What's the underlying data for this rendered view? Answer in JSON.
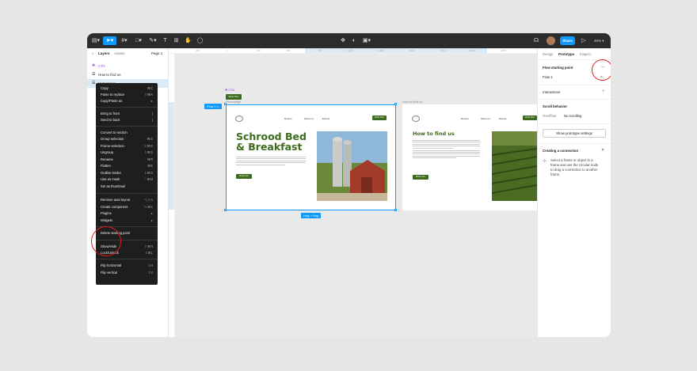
{
  "toolbar": {
    "tools": [
      "main-menu",
      "move",
      "frame",
      "shape",
      "pen",
      "text",
      "resources",
      "hand",
      "comment"
    ],
    "share_label": "Share",
    "zoom": "45%"
  },
  "left_panel": {
    "tabs": {
      "layers": "Layers",
      "assets": "Assets",
      "page": "Page 1"
    },
    "layers": [
      {
        "label": "CTA",
        "icon": "component-icon"
      },
      {
        "label": "How to find us",
        "icon": "frame-icon"
      },
      {
        "label": "Homepage",
        "icon": "frame-icon"
      }
    ]
  },
  "ruler": {
    "top": [
      "250",
      "0",
      "250",
      "500",
      "750",
      "1000",
      "1250",
      "1500",
      "1750",
      "2000",
      "2250"
    ],
    "left": [
      "-500",
      "-250",
      "0",
      "250",
      "500",
      "750",
      "1000",
      "1250"
    ]
  },
  "context_menu": {
    "groups": [
      [
        {
          "label": "Copy",
          "shortcut": "⌘C"
        },
        {
          "label": "Paste to replace",
          "shortcut": "⇧⌘R"
        },
        {
          "label": "Copy/Paste as",
          "shortcut": "▸"
        }
      ],
      [
        {
          "label": "Bring to front",
          "shortcut": "]"
        },
        {
          "label": "Send to back",
          "shortcut": "["
        }
      ],
      [
        {
          "label": "Convert to section",
          "shortcut": ""
        },
        {
          "label": "Group selection",
          "shortcut": "⌘G"
        },
        {
          "label": "Frame selection",
          "shortcut": "⌥⌘G"
        },
        {
          "label": "Ungroup",
          "shortcut": "⇧⌘G"
        },
        {
          "label": "Rename",
          "shortcut": "⌘R"
        },
        {
          "label": "Flatten",
          "shortcut": "⌘E"
        },
        {
          "label": "Outline stroke",
          "shortcut": "⇧⌘O"
        },
        {
          "label": "Use as mask",
          "shortcut": "⌃⌘M"
        },
        {
          "label": "Set as thumbnail",
          "shortcut": ""
        }
      ],
      [
        {
          "label": "Remove auto layout",
          "shortcut": "⌥⇧A"
        },
        {
          "label": "Create component",
          "shortcut": "⌥⌘K"
        },
        {
          "label": "Plugins",
          "shortcut": "▸"
        },
        {
          "label": "Widgets",
          "shortcut": "▸"
        }
      ],
      [
        {
          "label": "Delete starting point",
          "shortcut": ""
        }
      ],
      [
        {
          "label": "Show/Hide",
          "shortcut": "⇧⌘H"
        },
        {
          "label": "Lock/Unlock",
          "shortcut": "⇧⌘L"
        }
      ],
      [
        {
          "label": "Flip horizontal",
          "shortcut": "⇧H"
        },
        {
          "label": "Flip vertical",
          "shortcut": "⇧V"
        }
      ]
    ]
  },
  "canvas": {
    "cta": {
      "label": "CTA",
      "button": "Book Now"
    },
    "homepage": {
      "label": "Homepage",
      "flow_chip": "Flow 1",
      "nav": [
        "Rooms",
        "About us",
        "Events"
      ],
      "nav_button": "Book Now",
      "title_line1": "Schrood Bed",
      "title_line2": "& Breakfast",
      "button": "Book now",
      "size_chip": "Hug × Hug"
    },
    "find_us": {
      "label": "How to find us",
      "nav": [
        "Rooms",
        "About us",
        "Events"
      ],
      "nav_button": "Book Now",
      "title": "How to find us",
      "button": "Book now"
    }
  },
  "right_panel": {
    "tabs": {
      "design": "Design",
      "prototype": "Prototype",
      "inspect": "Inspect"
    },
    "flow_heading": "Flow starting point",
    "flow_name": "Flow 1",
    "interactions": "Interactions",
    "scroll_heading": "Scroll behavior",
    "overflow_label": "Overflow",
    "overflow_value": "No scrolling",
    "proto_settings": "Show prototype settings",
    "connection_heading": "Creating a connection",
    "connection_text_1": "Select a frame or object in a",
    "connection_text_2": "frame and use the circular node",
    "connection_text_3": "to drag a connection to another",
    "connection_text_4": "frame."
  },
  "colors": {
    "accent": "#0d99ff",
    "brand_green": "#3d6b1e",
    "annotation_red": "#e11d1d"
  }
}
